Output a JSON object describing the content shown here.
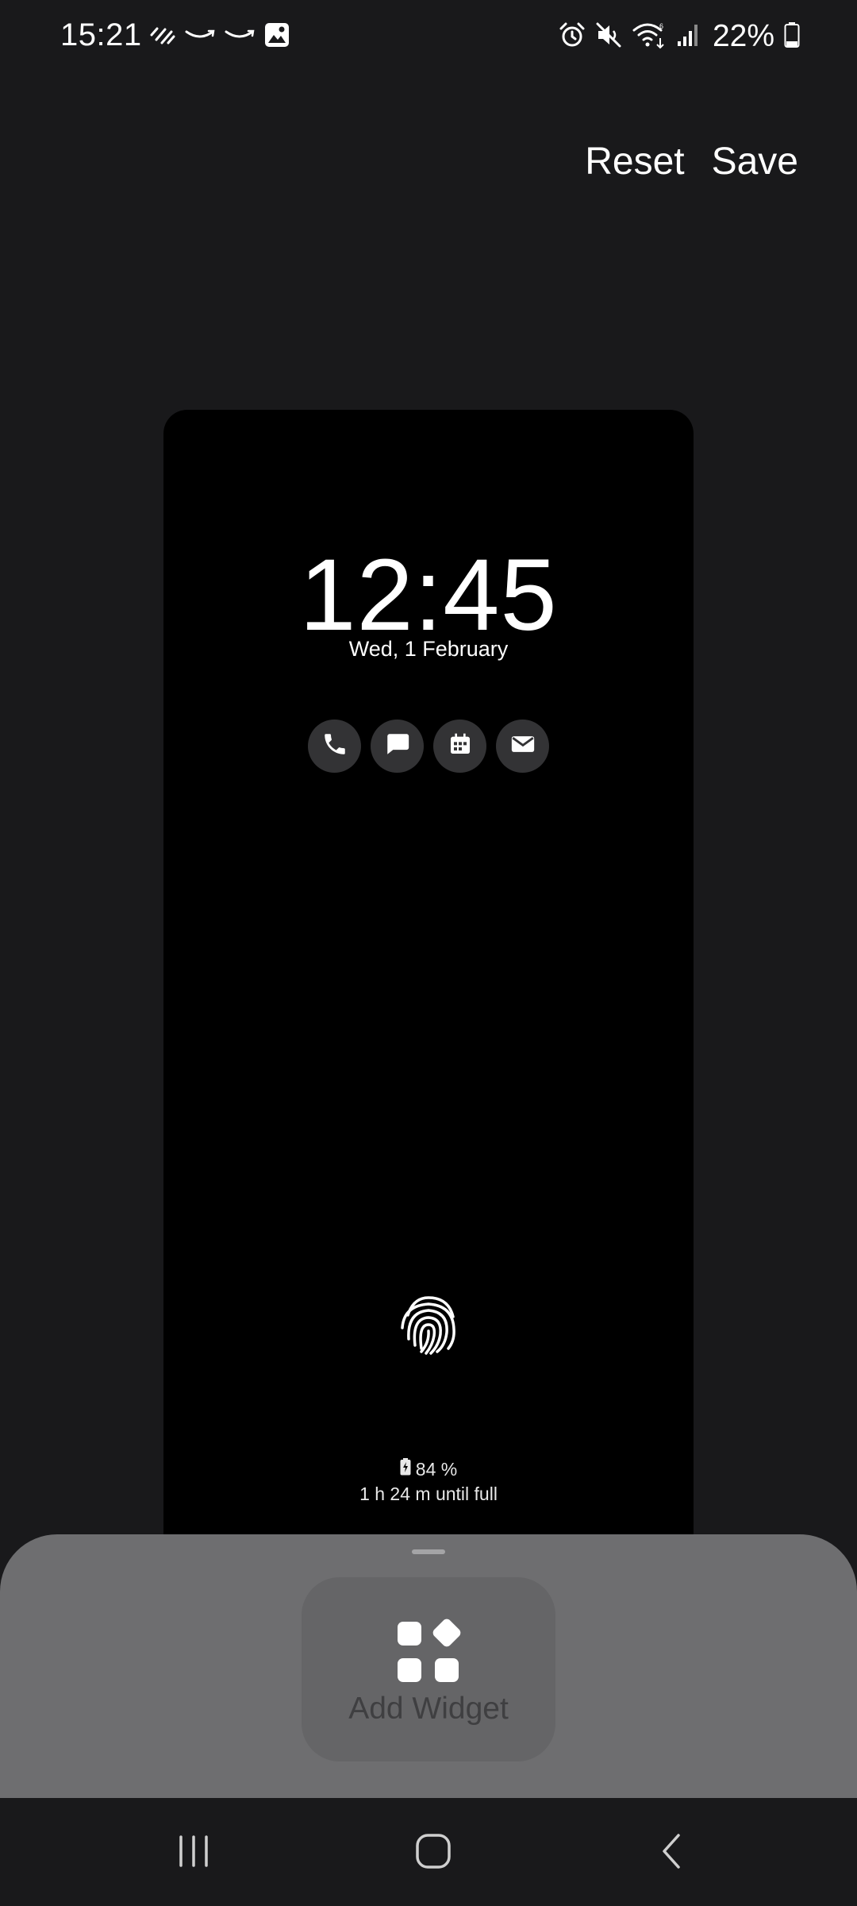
{
  "status_bar": {
    "time": "15:21",
    "battery": "22%",
    "left_icons": [
      "signal-waves-icon",
      "amazon-icon",
      "amazon-icon",
      "gallery-icon"
    ],
    "right_icons": [
      "alarm-icon",
      "mute-icon",
      "wifi-icon",
      "cell-signal-icon",
      "battery-icon"
    ]
  },
  "header": {
    "reset_label": "Reset",
    "save_label": "Save"
  },
  "preview": {
    "clock": "12:45",
    "date": "Wed, 1 February",
    "shortcuts": [
      "phone-icon",
      "message-icon",
      "calendar-icon",
      "email-icon"
    ],
    "battery_level": "84 %",
    "charge_time": "1 h 24 m until full"
  },
  "sheet": {
    "add_widget_label": "Add Widget"
  },
  "colors": {
    "background": "#19191b",
    "preview_background": "#000000",
    "sheet_background": "#6e6e70",
    "widget_button": "#656567"
  }
}
